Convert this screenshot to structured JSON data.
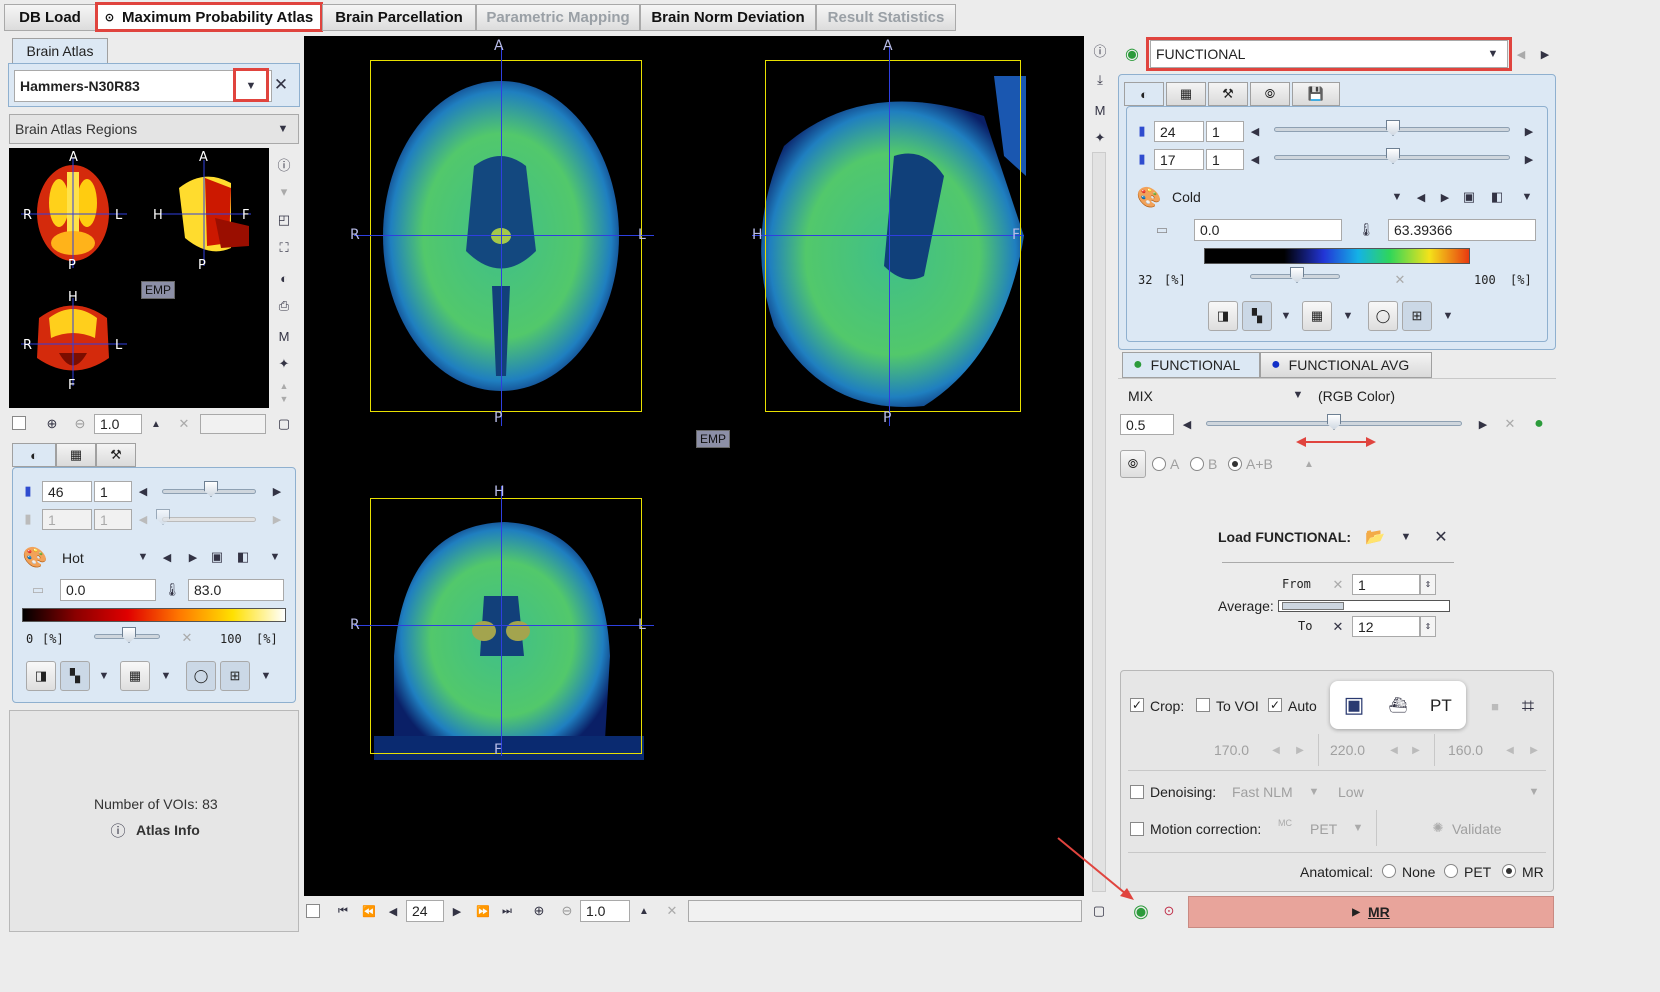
{
  "tabs": [
    {
      "label": "DB Load",
      "state": "normal"
    },
    {
      "label": "Maximum Probability Atlas",
      "state": "active"
    },
    {
      "label": "Brain Parcellation",
      "state": "normal"
    },
    {
      "label": "Parametric Mapping",
      "state": "disabled"
    },
    {
      "label": "Brain Norm Deviation",
      "state": "normal"
    },
    {
      "label": "Result Statistics",
      "state": "disabled"
    }
  ],
  "left": {
    "brain_atlas_tab": "Brain Atlas",
    "atlas_select": "Hammers-N30R83",
    "regions_select": "Brain Atlas Regions",
    "thumb_labels": {
      "a1": "A",
      "r1": "R",
      "l1": "L",
      "p1": "P",
      "a2": "A",
      "h2": "H",
      "f2": "F",
      "p2": "P",
      "h3": "H",
      "r3": "R",
      "l3": "L",
      "f3": "F",
      "emp": "EMP"
    },
    "zoom_value": "1.0",
    "slice_value": "46",
    "slice_step": "1",
    "frame_value": "1",
    "frame_step": "1",
    "colormap": "Hot",
    "min_value": "0.0",
    "max_value": "83.0",
    "pct_min": "0",
    "pct_max": "100",
    "pct_unit": "[%]",
    "num_vois": "Number of VOIs: 83",
    "atlas_info": "Atlas Info"
  },
  "viewer": {
    "axial": {
      "top": "A",
      "bottom": "P",
      "left": "R",
      "right": "L"
    },
    "sagittal": {
      "top": "A",
      "bottom": "P",
      "left": "H",
      "right": "F"
    },
    "coronal": {
      "top": "H",
      "bottom": "F",
      "left": "R",
      "right": "L"
    },
    "emp": "EMP",
    "slice": "24",
    "zoom": "1.0"
  },
  "right": {
    "series_select": "FUNCTIONAL",
    "slice_value": "24",
    "slice_step": "1",
    "frame_value": "17",
    "frame_step": "1",
    "colormap": "Cold",
    "min_value": "0.0",
    "max_value": "63.39366",
    "pct_min": "32",
    "pct_max": "100",
    "pct_unit": "[%]",
    "fusion_tabs": [
      "FUNCTIONAL",
      "FUNCTIONAL AVG"
    ],
    "mix_label": "MIX",
    "mix_mode": "(RGB Color)",
    "mix_value": "0.5",
    "radio_a": "A",
    "radio_b": "B",
    "radio_ab": "A+B",
    "load_label": "Load FUNCTIONAL:",
    "from_label": "From",
    "from_value": "1",
    "average_label": "Average:",
    "to_label": "To",
    "to_value": "12",
    "crop_label": "Crop:",
    "tovoi_label": "To VOI",
    "auto_label": "Auto",
    "pt_label": "PT",
    "crop_x": "170.0",
    "crop_y": "220.0",
    "crop_z": "160.0",
    "denoising_label": "Denoising:",
    "denoising_method": "Fast NLM",
    "denoising_level": "Low",
    "motion_label": "Motion correction:",
    "motion_mode": "PET",
    "mc_badge": "MC",
    "validate_label": "Validate",
    "anatomical_label": "Anatomical:",
    "anat_none": "None",
    "anat_pet": "PET",
    "anat_mr": "MR",
    "mr_button": "MR"
  },
  "colors": {
    "accent_red": "#e0443e",
    "mr_button_bg": "#e8a49b",
    "crosshair": "#2f3fe0",
    "frame": "#e8e000"
  }
}
